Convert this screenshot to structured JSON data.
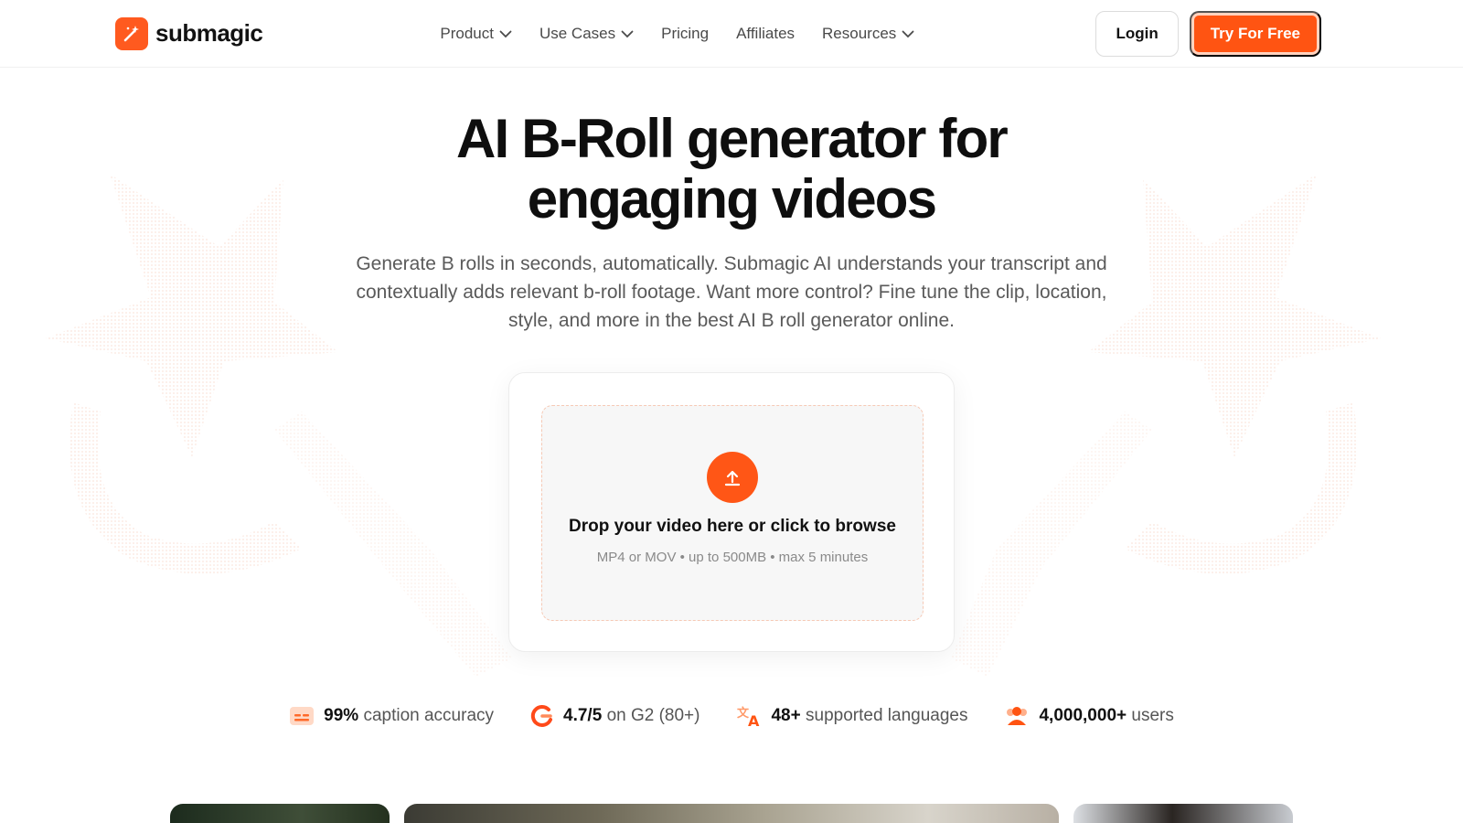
{
  "brand": {
    "name": "submagic",
    "accent": "#ff5412"
  },
  "nav": {
    "items": [
      {
        "label": "Product",
        "has_dropdown": true
      },
      {
        "label": "Use Cases",
        "has_dropdown": true
      },
      {
        "label": "Pricing",
        "has_dropdown": false
      },
      {
        "label": "Affiliates",
        "has_dropdown": false
      },
      {
        "label": "Resources",
        "has_dropdown": true
      }
    ],
    "login_label": "Login",
    "cta_label": "Try For Free"
  },
  "hero": {
    "title_line1": "AI B-Roll generator for",
    "title_line2": "engaging videos",
    "subtitle": "Generate B rolls in seconds, automatically. Submagic AI understands your transcript and contextually adds relevant b-roll footage. Want more control? Fine tune the clip, location, style, and more in the best AI B roll generator online."
  },
  "upload": {
    "icon": "upload-icon",
    "title": "Drop your video here or click to browse",
    "meta": "MP4 or MOV • up to 500MB • max 5 minutes"
  },
  "stats": [
    {
      "icon": "caption-icon",
      "value": "99%",
      "label": "caption accuracy"
    },
    {
      "icon": "g2-icon",
      "value": "4.7/5",
      "label": "on G2 (80+)"
    },
    {
      "icon": "translate-icon",
      "value": "48+",
      "label": "supported languages"
    },
    {
      "icon": "users-icon",
      "value": "4,000,000+",
      "label": "users"
    }
  ]
}
